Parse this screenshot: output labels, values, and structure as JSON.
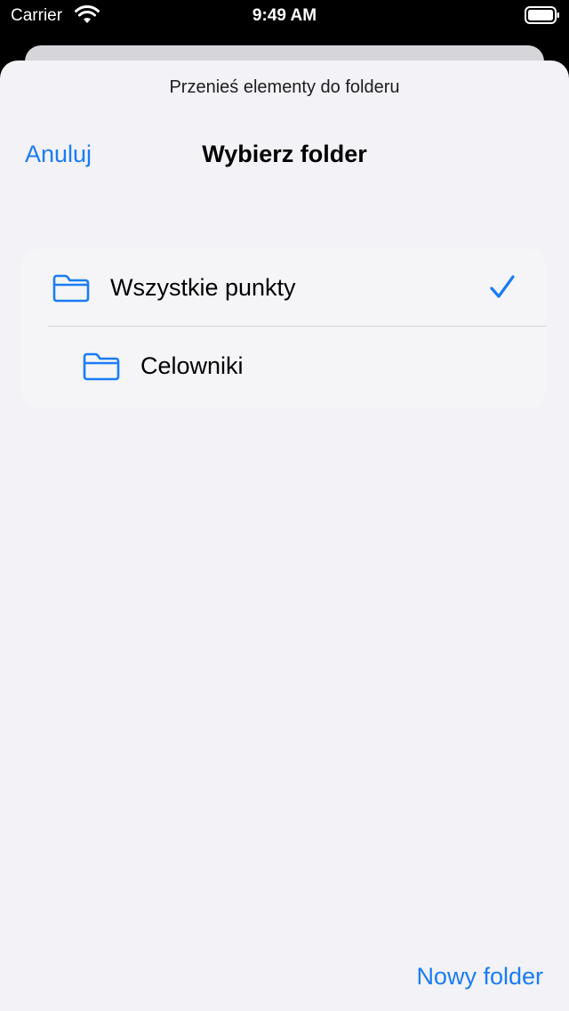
{
  "status_bar": {
    "carrier": "Carrier",
    "time": "9:49 AM"
  },
  "sheet": {
    "prompt": "Przenieś elementy do folderu",
    "nav": {
      "cancel_label": "Anuluj",
      "title": "Wybierz folder"
    },
    "folders": [
      {
        "label": "Wszystkie punkty",
        "selected": true,
        "icon": "folder-icon"
      },
      {
        "label": "Celowniki",
        "selected": false,
        "icon": "folder-icon"
      }
    ],
    "new_folder_label": "Nowy folder"
  },
  "colors": {
    "accent": "#1a7cf5",
    "sheet_background": "#f2f2f7",
    "list_background": "#f5f5f8"
  }
}
